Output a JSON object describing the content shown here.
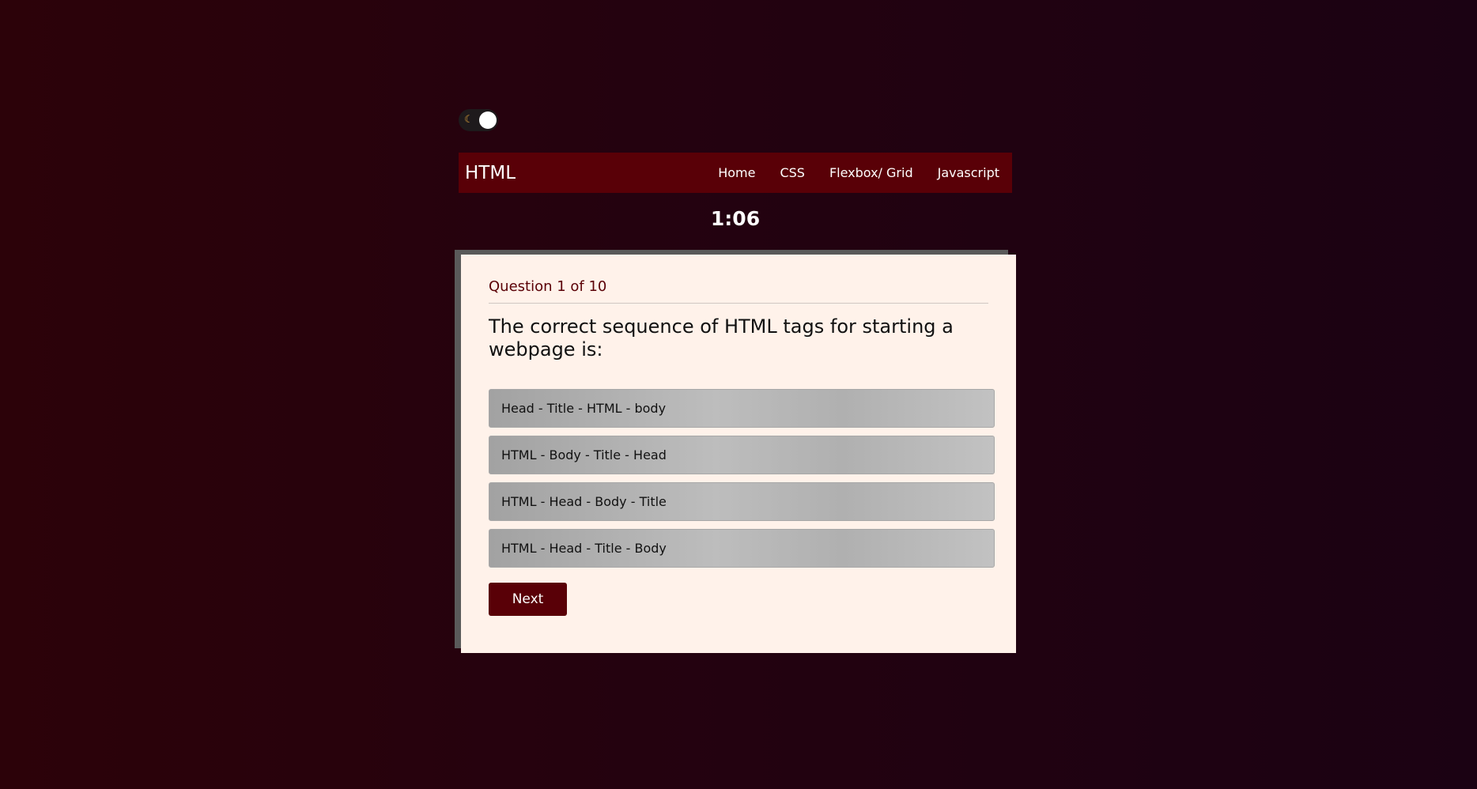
{
  "theme_toggle": {
    "icon": "moon-icon",
    "icon_color": "#e0a33a"
  },
  "navbar": {
    "brand": "HTML",
    "links": [
      "Home",
      "CSS",
      "Flexbox/ Grid",
      "Javascript"
    ],
    "background": "#590007"
  },
  "timer": "1:06",
  "quiz": {
    "counter": "Question 1 of 10",
    "question": "The correct sequence of HTML tags for starting a webpage is:",
    "answers": [
      "Head - Title - HTML - body",
      "HTML - Body - Title - Head",
      "HTML - Head - Body - Title",
      "HTML - Head - Title - Body"
    ],
    "next_label": "Next"
  }
}
